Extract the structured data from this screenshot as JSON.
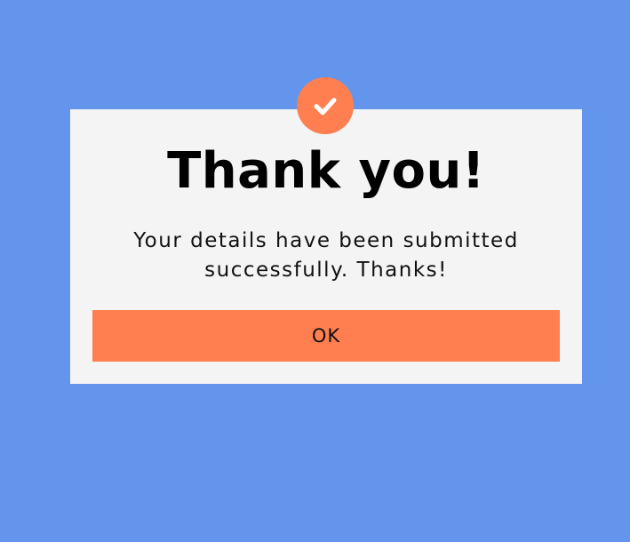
{
  "dialog": {
    "icon": "check-icon",
    "title": "Thank you!",
    "message": "Your details have been submitted successfully. Thanks!",
    "ok_label": "OK"
  },
  "colors": {
    "background": "#6495ed",
    "modal": "#f4f4f4",
    "accent": "#ff7f50",
    "text": "#000000"
  }
}
